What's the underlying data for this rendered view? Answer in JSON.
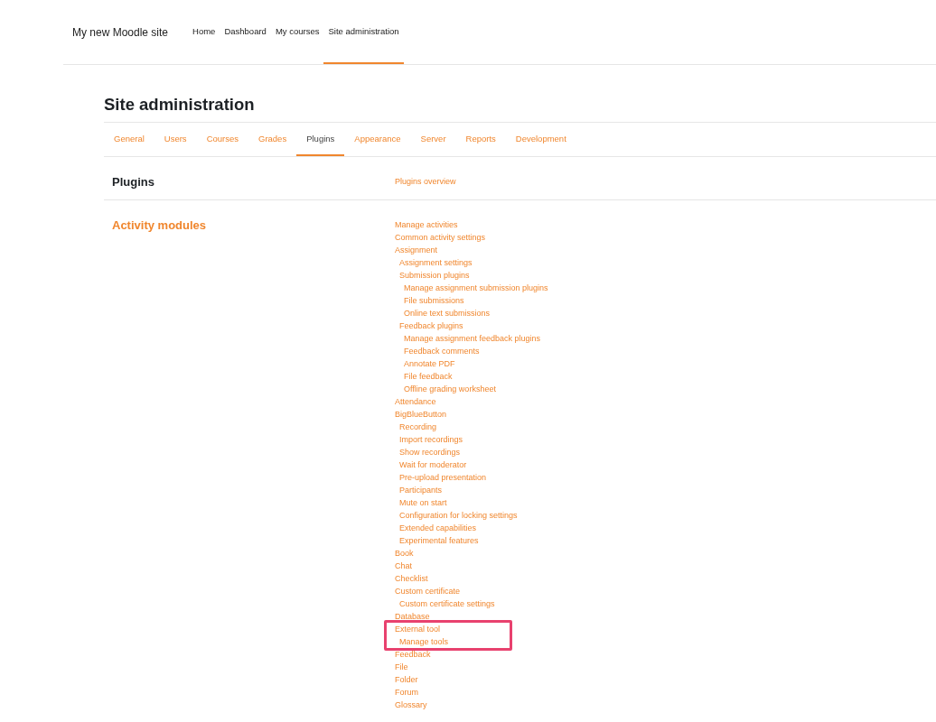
{
  "site_name": "My new Moodle site",
  "nav": [
    {
      "label": "Home",
      "selected": false
    },
    {
      "label": "Dashboard",
      "selected": false
    },
    {
      "label": "My courses",
      "selected": false
    },
    {
      "label": "Site administration",
      "selected": true
    }
  ],
  "page_title": "Site administration",
  "tabs": [
    {
      "label": "General",
      "selected": false
    },
    {
      "label": "Users",
      "selected": false
    },
    {
      "label": "Courses",
      "selected": false
    },
    {
      "label": "Grades",
      "selected": false
    },
    {
      "label": "Plugins",
      "selected": true
    },
    {
      "label": "Appearance",
      "selected": false
    },
    {
      "label": "Server",
      "selected": false
    },
    {
      "label": "Reports",
      "selected": false
    },
    {
      "label": "Development",
      "selected": false
    }
  ],
  "sections": [
    {
      "title": "Plugins",
      "is_link": false,
      "items": [
        {
          "label": "Plugins overview"
        }
      ]
    },
    {
      "title": "Activity modules",
      "is_link": true,
      "items": [
        {
          "label": "Manage activities"
        },
        {
          "label": "Common activity settings"
        },
        {
          "label": "Assignment",
          "children": [
            {
              "label": "Assignment settings"
            },
            {
              "label": "Submission plugins",
              "children": [
                {
                  "label": "Manage assignment submission plugins"
                },
                {
                  "label": "File submissions"
                },
                {
                  "label": "Online text submissions"
                }
              ]
            },
            {
              "label": "Feedback plugins",
              "children": [
                {
                  "label": "Manage assignment feedback plugins"
                },
                {
                  "label": "Feedback comments"
                },
                {
                  "label": "Annotate PDF"
                },
                {
                  "label": "File feedback"
                },
                {
                  "label": "Offline grading worksheet"
                }
              ]
            }
          ]
        },
        {
          "label": "Attendance"
        },
        {
          "label": "BigBlueButton",
          "children": [
            {
              "label": "Recording"
            },
            {
              "label": "Import recordings"
            },
            {
              "label": "Show recordings"
            },
            {
              "label": "Wait for moderator"
            },
            {
              "label": "Pre-upload presentation"
            },
            {
              "label": "Participants"
            },
            {
              "label": "Mute on start"
            },
            {
              "label": "Configuration for locking settings"
            },
            {
              "label": "Extended capabilities"
            },
            {
              "label": "Experimental features"
            }
          ]
        },
        {
          "label": "Book"
        },
        {
          "label": "Chat"
        },
        {
          "label": "Checklist"
        },
        {
          "label": "Custom certificate",
          "children": [
            {
              "label": "Custom certificate settings"
            }
          ]
        },
        {
          "label": "Database"
        },
        {
          "label": "External tool",
          "highlighted": true,
          "children": [
            {
              "label": "Manage tools"
            }
          ]
        },
        {
          "label": "Feedback"
        },
        {
          "label": "File"
        },
        {
          "label": "Folder"
        },
        {
          "label": "Forum"
        },
        {
          "label": "Glossary"
        }
      ]
    }
  ]
}
